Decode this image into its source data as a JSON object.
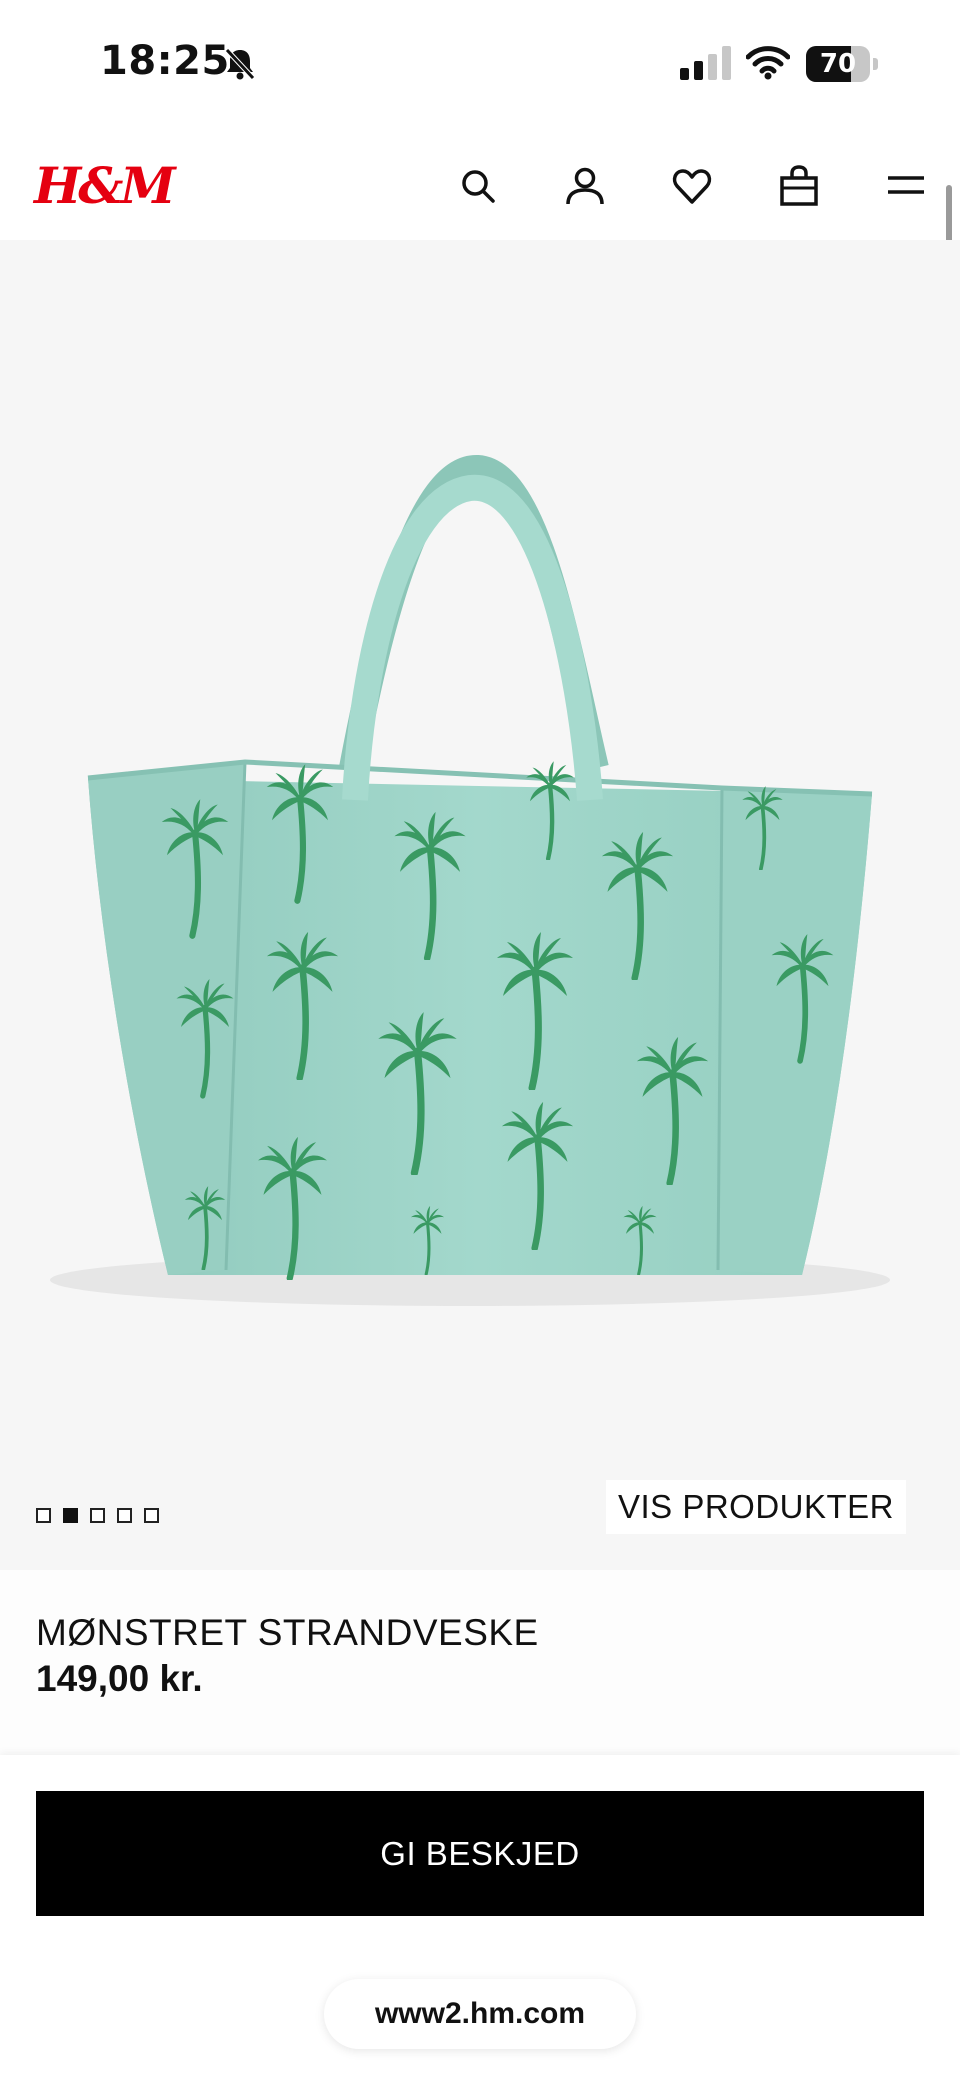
{
  "status_bar": {
    "time": "18:25",
    "battery_percent": "70",
    "battery_level": 0.7,
    "icons": [
      "bell-slash-icon",
      "signal-icon",
      "wifi-icon",
      "battery-icon"
    ]
  },
  "header": {
    "logo": "H&M",
    "icons": [
      "search-icon",
      "account-icon",
      "heart-icon",
      "bag-icon",
      "menu-icon"
    ]
  },
  "gallery": {
    "image_count": 5,
    "active_index": 1,
    "view_products_label": "VIS PRODUKTER"
  },
  "product": {
    "name": "MØNSTRET STRANDVESKE",
    "price": "149,00 kr."
  },
  "cta": {
    "label": "GI BESKJED"
  },
  "browser": {
    "url": "www2.hm.com"
  },
  "colors": {
    "brand_red": "#e50010",
    "bag_mint": "#9ed3c8",
    "palm_green": "#3a9a63",
    "button_black": "#000000"
  }
}
